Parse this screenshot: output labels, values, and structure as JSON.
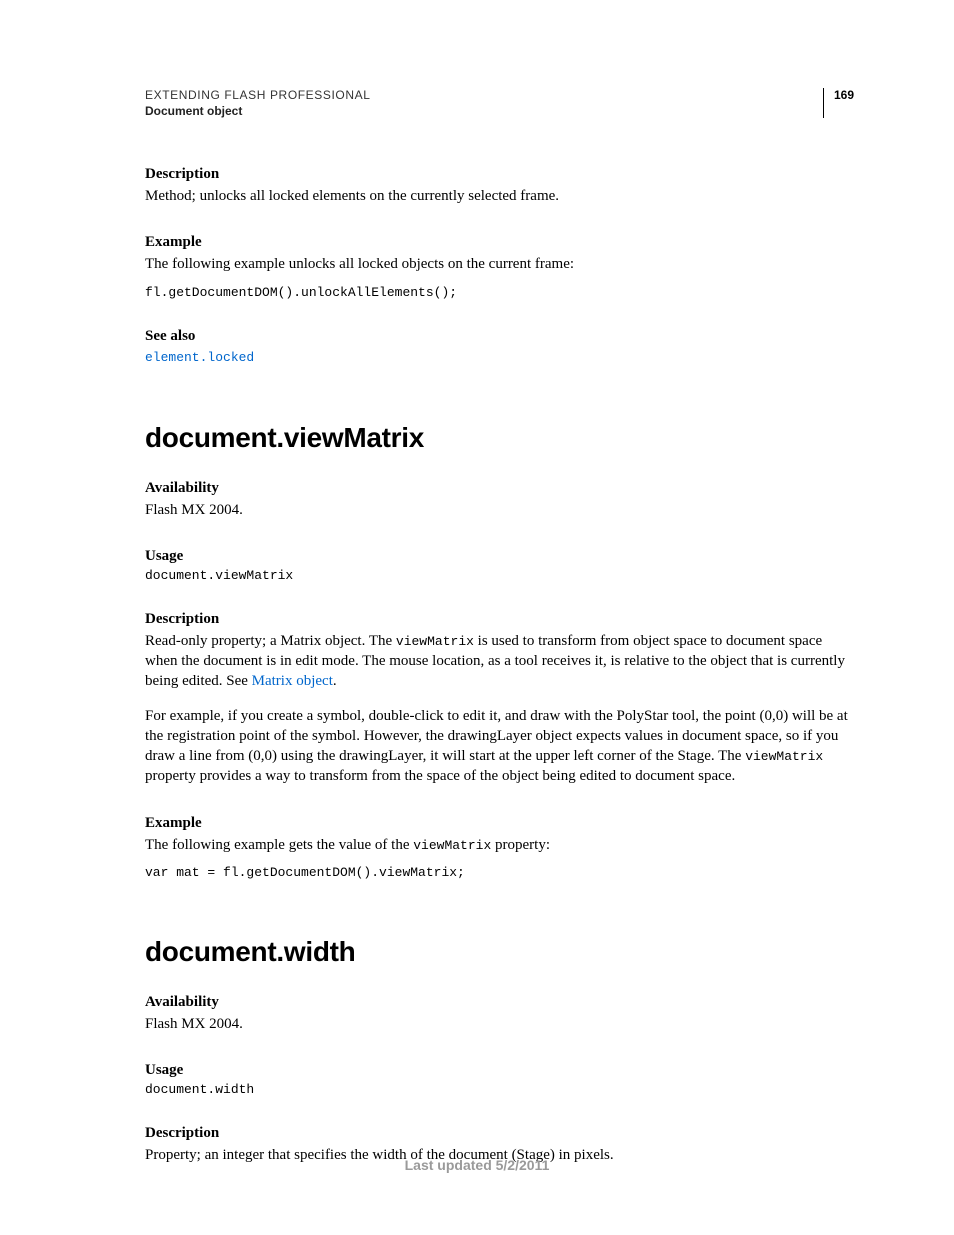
{
  "header": {
    "running_head": "EXTENDING FLASH PROFESSIONAL",
    "running_sub": "Document object",
    "page_number": "169"
  },
  "section1": {
    "description_label": "Description",
    "description_text": "Method; unlocks all locked elements on the currently selected frame.",
    "example_label": "Example",
    "example_text": "The following example unlocks all locked objects on the current frame:",
    "example_code": "fl.getDocumentDOM().unlockAllElements();",
    "seealso_label": "See also",
    "seealso_link": "element.locked"
  },
  "section2": {
    "title": "document.viewMatrix",
    "availability_label": "Availability",
    "availability_text": "Flash MX 2004.",
    "usage_label": "Usage",
    "usage_code": "document.viewMatrix",
    "description_label": "Description",
    "desc_p1_a": "Read-only property; a Matrix object. The ",
    "desc_p1_code": "viewMatrix",
    "desc_p1_b": " is used to transform from object space to document space when the document is in edit mode. The mouse location, as a tool receives it, is relative to the object that is currently being edited. See ",
    "desc_p1_link": "Matrix object",
    "desc_p1_c": ".",
    "desc_p2_a": "For example, if you create a symbol, double-click to edit it, and draw with the PolyStar tool, the point (0,0) will be at the registration point of the symbol. However, the drawingLayer object expects values in document space, so if you draw a line from (0,0) using the drawingLayer, it will start at the upper left corner of the Stage. The ",
    "desc_p2_code": "viewMatrix",
    "desc_p2_b": " property provides a way to transform from the space of the object being edited to document space.",
    "example_label": "Example",
    "example_text_a": "The following example gets the value of the ",
    "example_text_code": "viewMatrix",
    "example_text_b": " property:",
    "example_code": "var mat = fl.getDocumentDOM().viewMatrix;"
  },
  "section3": {
    "title": "document.width",
    "availability_label": "Availability",
    "availability_text": "Flash MX 2004.",
    "usage_label": "Usage",
    "usage_code": "document.width",
    "description_label": "Description",
    "description_text": "Property; an integer that specifies the width of the document (Stage) in pixels."
  },
  "footer": {
    "text": "Last updated 5/2/2011"
  }
}
